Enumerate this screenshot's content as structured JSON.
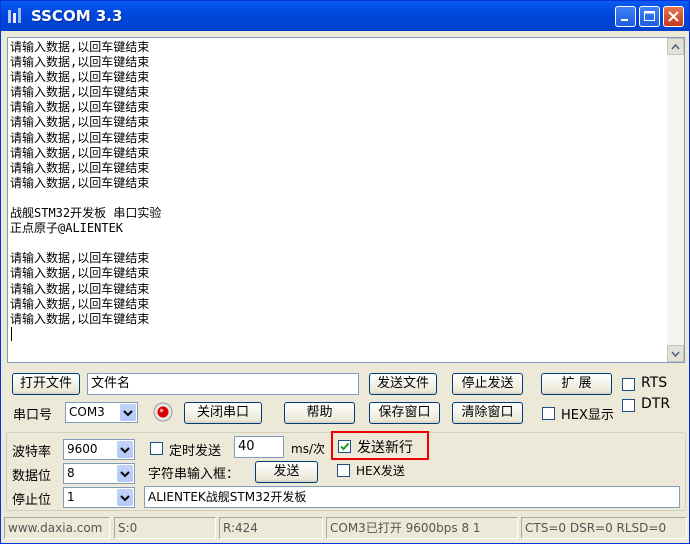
{
  "window": {
    "title": "SSCOM 3.3"
  },
  "output": {
    "lines": [
      "请输入数据,以回车键结束",
      "请输入数据,以回车键结束",
      "请输入数据,以回车键结束",
      "请输入数据,以回车键结束",
      "请输入数据,以回车键结束",
      "请输入数据,以回车键结束",
      "请输入数据,以回车键结束",
      "请输入数据,以回车键结束",
      "请输入数据,以回车键结束",
      "请输入数据,以回车键结束",
      "",
      "战舰STM32开发板 串口实验",
      "正点原子@ALIENTEK",
      "",
      "请输入数据,以回车键结束",
      "请输入数据,以回车键结束",
      "请输入数据,以回车键结束",
      "请输入数据,以回车键结束",
      "请输入数据,以回车键结束"
    ]
  },
  "file_row": {
    "open_file": "打开文件",
    "file_name": "文件名",
    "send_file": "发送文件",
    "stop_send": "停止发送",
    "expand": "扩 展",
    "rts": "RTS"
  },
  "port_row": {
    "port_label": "串口号",
    "port_value": "COM3",
    "close_port": "关闭串口",
    "help": "帮助",
    "save_window": "保存窗口",
    "clear_window": "清除窗口",
    "hex_display": "HEX显示",
    "dtr": "DTR"
  },
  "settings": {
    "baud_label": "波特率",
    "baud_value": "9600",
    "data_bits_label": "数据位",
    "data_bits_value": "8",
    "stop_bits_label": "停止位",
    "stop_bits_value": "1",
    "timed_send": "定时发送",
    "interval_value": "40",
    "interval_unit": "ms/次",
    "send_newline": "发送新行",
    "send_newline_checked": true,
    "input_box_label": "字符串输入框：",
    "send": "发送",
    "hex_send": "HEX发送",
    "send_text": "ALIENTEK战舰STM32开发板"
  },
  "status": {
    "website": "www.daxia.com",
    "sent": "S:0",
    "received": "R:424",
    "port_status": "COM3已打开  9600bps  8 1",
    "lines": "CTS=0 DSR=0 RLSD=0"
  }
}
